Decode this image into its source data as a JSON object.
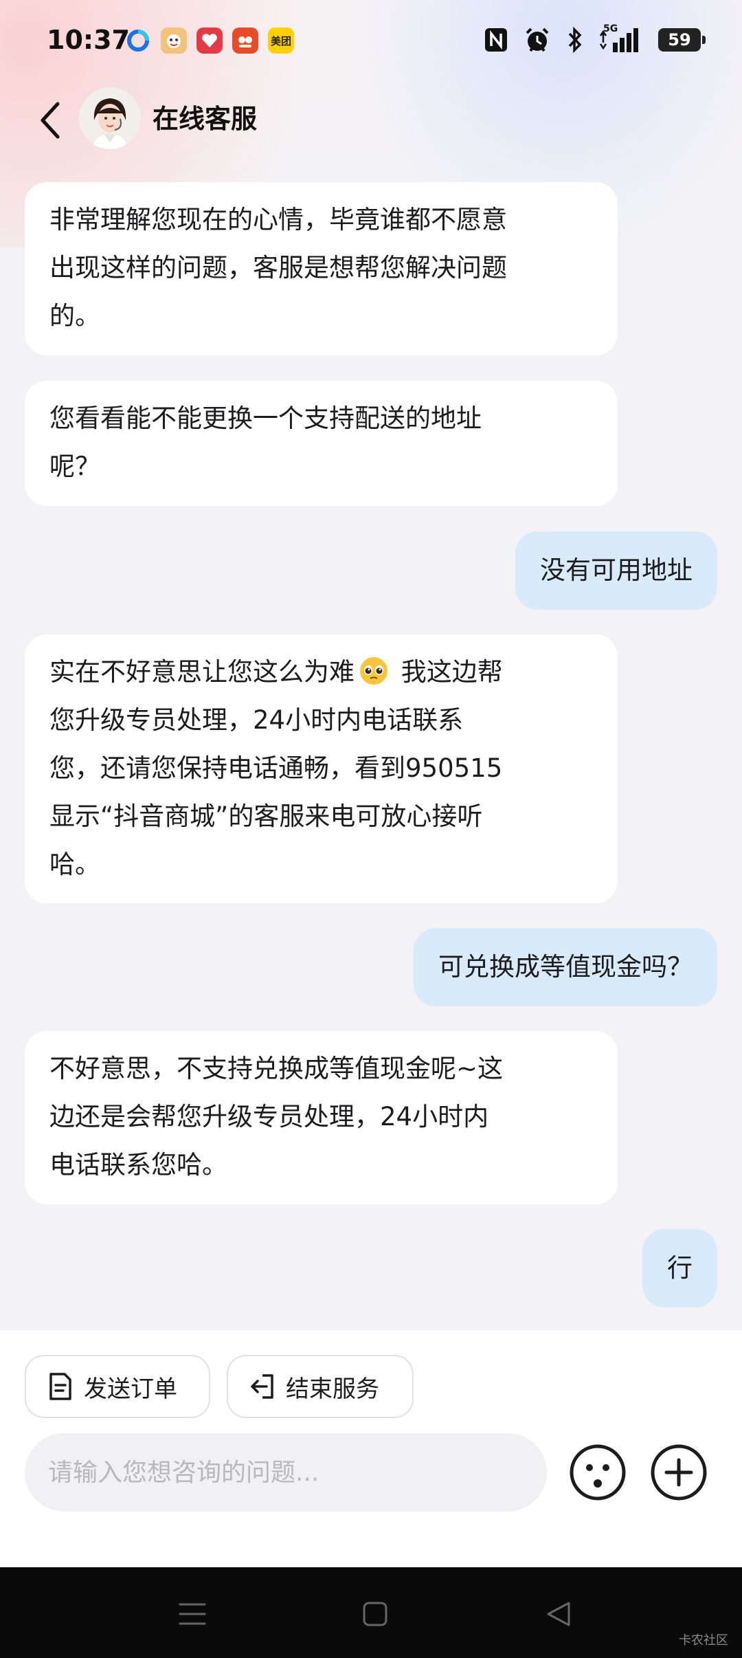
{
  "status_bar": {
    "time": "10:37",
    "network": "5G",
    "battery": "59",
    "apps": [
      {
        "name": "browser-icon",
        "label": "",
        "color": "#1a73e8"
      },
      {
        "name": "game-app-icon",
        "label": "",
        "color": "#f0a040"
      },
      {
        "name": "shopping-app-icon",
        "label": "",
        "color": "#e63946"
      },
      {
        "name": "pinduoduo-icon",
        "label": "",
        "color": "#e84a2a"
      },
      {
        "name": "meituan-icon",
        "label": "美团",
        "color": "#ffd100"
      }
    ]
  },
  "header": {
    "title": "在线客服"
  },
  "messages": [
    {
      "from": "agent",
      "lines": [
        "非常理解您现在的心情，毕竟谁都不愿意",
        "出现这样的问题，客服是想帮您解决问题",
        "的。"
      ]
    },
    {
      "from": "agent",
      "lines": [
        "您看看能不能更换一个支持配送的地址",
        "呢？"
      ]
    },
    {
      "from": "user",
      "text": "没有可用地址"
    },
    {
      "from": "agent",
      "lines": [
        "实在不好意思让您这么为难",
        " 我这边帮",
        "您升级专员处理，24小时内电话联系",
        "您，还请您保持电话通畅，看到950515",
        "显示“抖音商城”的客服来电可放心接听",
        "哈。"
      ],
      "emoji": "pleading-face-emoji"
    },
    {
      "from": "user",
      "text": "可兑换成等值现金吗？"
    },
    {
      "from": "agent",
      "lines": [
        "不好意思，不支持兑换成等值现金呢~这",
        "边还是会帮您升级专员处理，24小时内",
        "电话联系您哈。"
      ]
    },
    {
      "from": "user",
      "text": "行"
    }
  ],
  "quick_actions": {
    "send_order": "发送订单",
    "end_service": "结束服务"
  },
  "input": {
    "placeholder": "请输入您想咨询的问题...",
    "value": ""
  },
  "watermark": "卡农社区",
  "colors": {
    "user_bubble": "#d9eafb",
    "agent_bubble": "#ffffff",
    "background": "#f3f3f5"
  }
}
